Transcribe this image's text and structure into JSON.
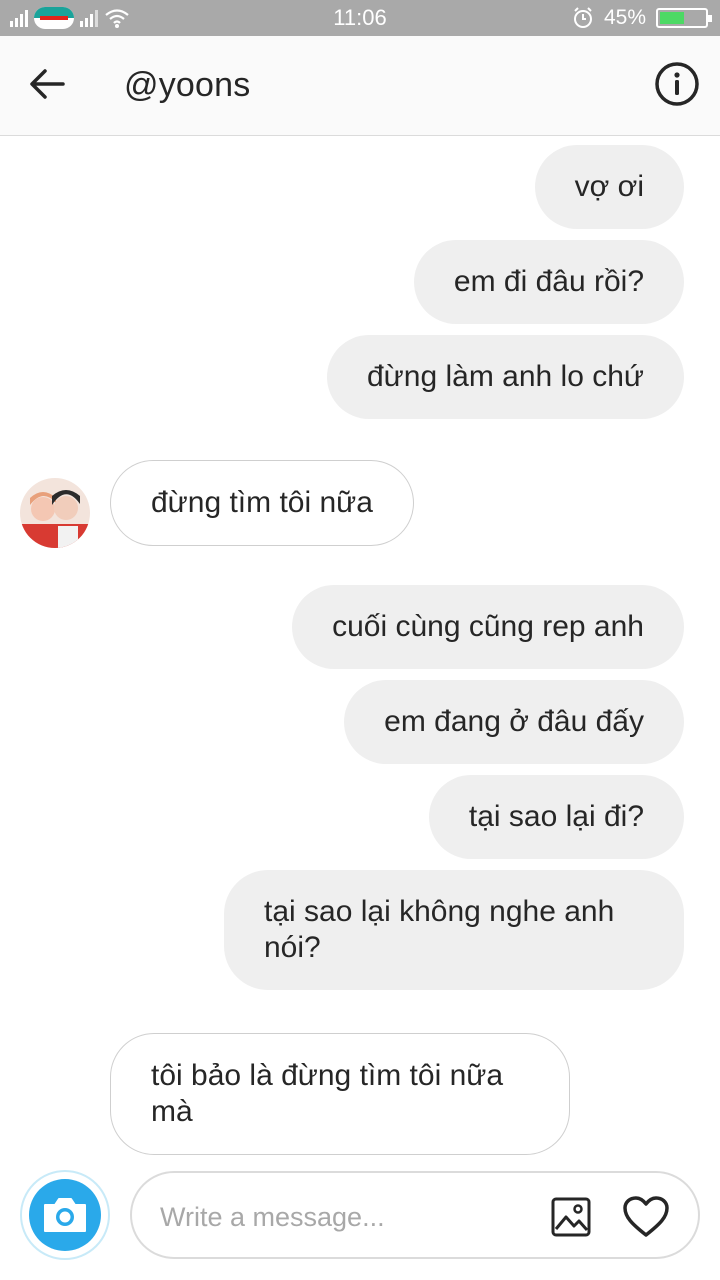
{
  "status_bar": {
    "time": "11:06",
    "battery_percent": "45%",
    "carrier": "viettel"
  },
  "header": {
    "title": "@yoons",
    "back_icon": "arrow-left-icon",
    "info_icon": "info-icon"
  },
  "messages": [
    {
      "direction": "out",
      "text": "vợ ơi"
    },
    {
      "direction": "out",
      "text": "em đi đâu rồi?"
    },
    {
      "direction": "out",
      "text": "đừng làm anh lo chứ"
    },
    {
      "direction": "in",
      "text": "đừng tìm tôi nữa"
    },
    {
      "direction": "out",
      "text": "cuối cùng cũng rep anh"
    },
    {
      "direction": "out",
      "text": "em đang ở đâu đấy"
    },
    {
      "direction": "out",
      "text": "tại sao lại đi?"
    },
    {
      "direction": "out",
      "text": "tại sao lại không nghe anh nói?"
    },
    {
      "direction": "in",
      "text": "tôi bảo là đừng tìm tôi nữa mà"
    }
  ],
  "composer": {
    "placeholder": "Write a message...",
    "value": ""
  },
  "colors": {
    "outgoing_bubble": "#efefef",
    "camera_button": "#2aa9ea",
    "status_bar": "#a9a9a9",
    "battery_fill": "#4cd964"
  }
}
